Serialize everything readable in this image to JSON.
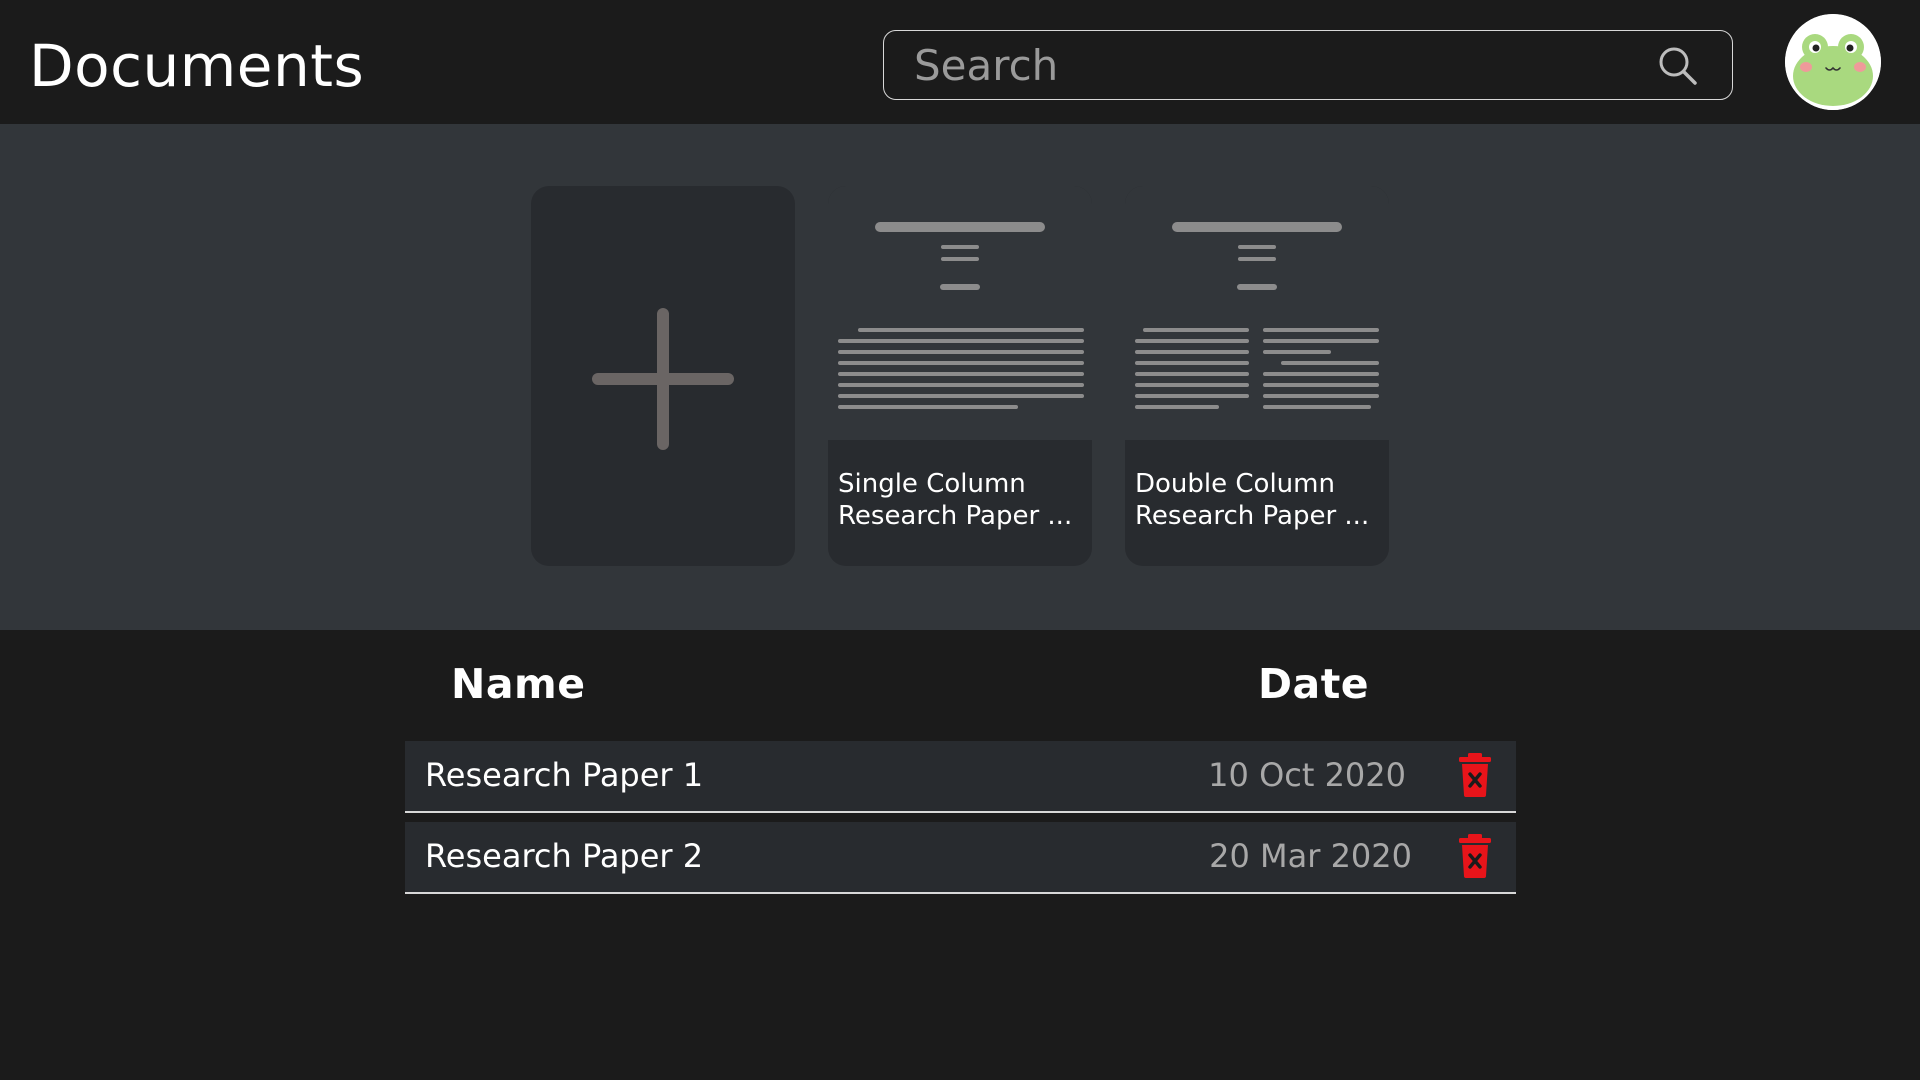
{
  "header": {
    "title": "Documents",
    "search": {
      "placeholder": "Search",
      "value": ""
    },
    "avatar_icon": "frog-avatar-icon"
  },
  "templates": {
    "new_icon": "plus-icon",
    "items": [
      {
        "label": "Single Column Research Paper ..."
      },
      {
        "label": "Double Column Research Paper ..."
      }
    ]
  },
  "table": {
    "columns": [
      "Name",
      "Date"
    ],
    "rows": [
      {
        "name": "Research Paper 1",
        "date": "10 Oct 2020",
        "action_icon": "trash-icon"
      },
      {
        "name": "Research Paper 2",
        "date": "20 Mar 2020",
        "action_icon": "trash-icon"
      }
    ]
  },
  "colors": {
    "background": "#1b1b1b",
    "band": "#32363a",
    "card": "#282b2f",
    "delete": "#e8141a"
  }
}
